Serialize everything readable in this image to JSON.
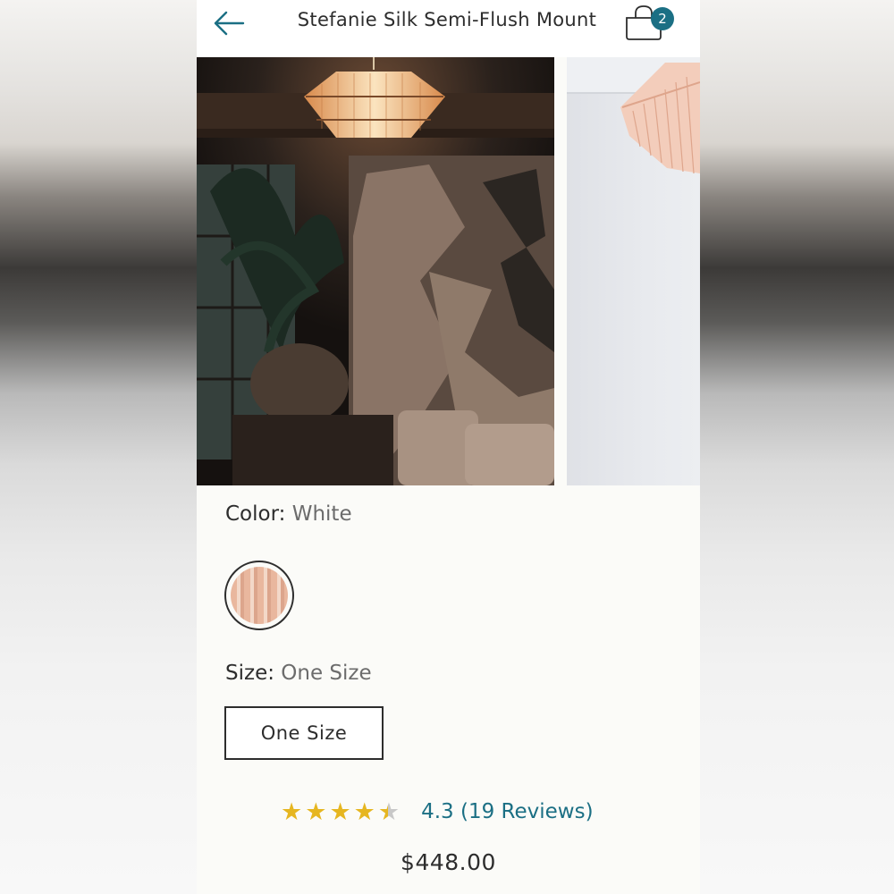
{
  "header": {
    "title": "Stefanie Silk Semi-Flush Mount",
    "cart_count": "2"
  },
  "gallery": {
    "images": [
      {
        "alt": "Lamp photo 1"
      },
      {
        "alt": "Lamp photo 2"
      }
    ]
  },
  "color": {
    "label": "Color:",
    "value": "White"
  },
  "size": {
    "label": "Size:",
    "value": "One Size",
    "option": "One Size"
  },
  "rating": {
    "stars": 4.3,
    "text": "4.3 (19 Reviews)"
  },
  "price": "$448.00",
  "colors": {
    "accent": "#1b6f84",
    "star": "#e6b620",
    "text": "#2d2d2d"
  },
  "icons": [
    "back-arrow-icon",
    "shopping-bag-icon",
    "star-icon"
  ]
}
